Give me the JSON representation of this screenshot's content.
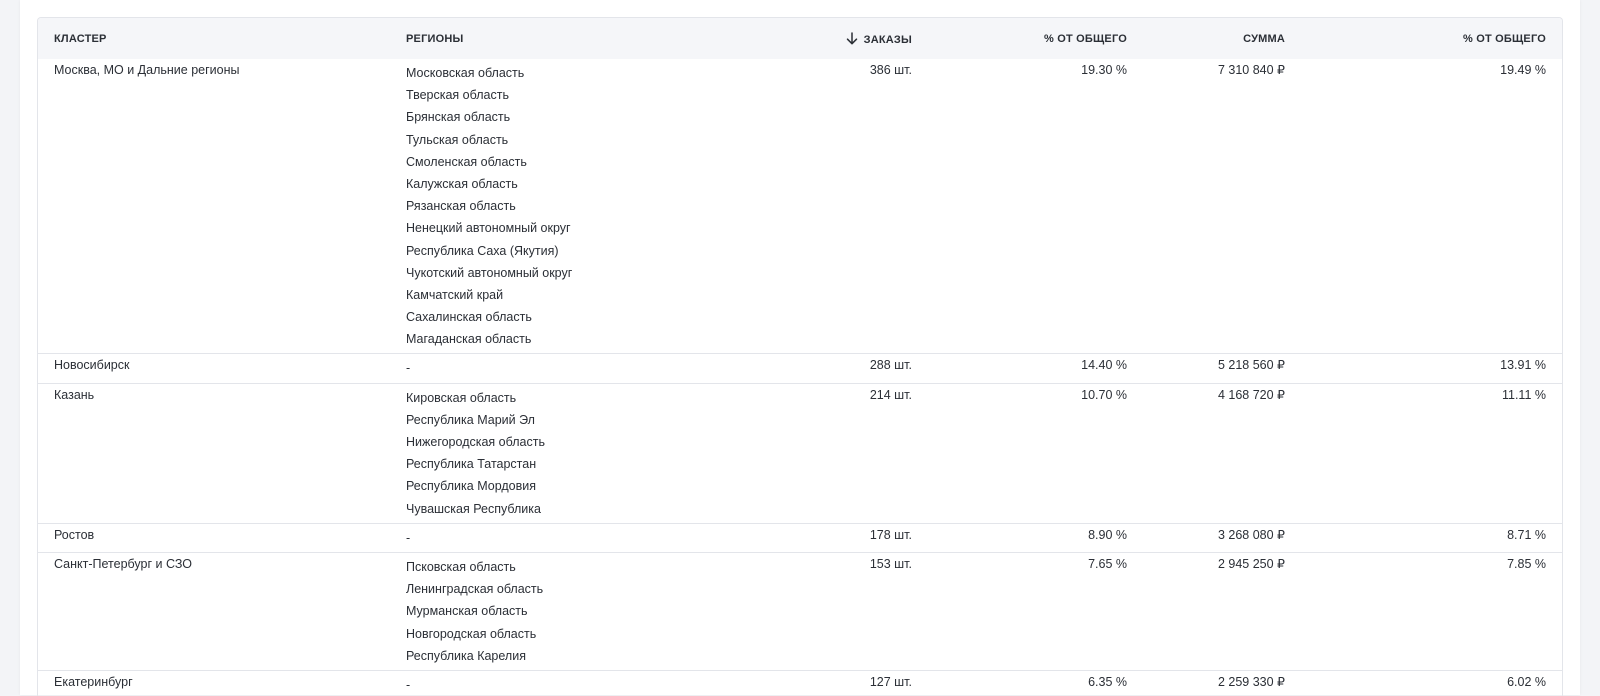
{
  "table": {
    "columns": {
      "cluster": "КЛАСТЕР",
      "regions": "РЕГИОНЫ",
      "orders": "ЗАКАЗЫ",
      "orders_pct": "% ОТ ОБЩЕГО",
      "sum": "СУММА",
      "sum_pct": "% ОТ ОБЩЕГО"
    },
    "sort": {
      "column": "orders",
      "direction": "desc",
      "icon": "arrow-down-icon"
    },
    "rows": [
      {
        "cluster": "Москва, МО и Дальние регионы",
        "regions": [
          "Московская область",
          "Тверская область",
          "Брянская область",
          "Тульская область",
          "Смоленская область",
          "Калужская область",
          "Рязанская область",
          "Ненецкий автономный округ",
          "Республика Саха (Якутия)",
          "Чукотский автономный округ",
          "Камчатский край",
          "Сахалинская область",
          "Магаданская область"
        ],
        "orders": "386 шт.",
        "orders_pct": "19.30 %",
        "sum": "7 310 840 ₽",
        "sum_pct": "19.49 %"
      },
      {
        "cluster": "Новосибирск",
        "regions": [
          "-"
        ],
        "orders": "288 шт.",
        "orders_pct": "14.40 %",
        "sum": "5 218 560 ₽",
        "sum_pct": "13.91 %"
      },
      {
        "cluster": "Казань",
        "regions": [
          "Кировская область",
          "Республика Марий Эл",
          "Нижегородская область",
          "Республика Татарстан",
          "Республика Мордовия",
          "Чувашская Республика"
        ],
        "orders": "214 шт.",
        "orders_pct": "10.70 %",
        "sum": "4 168 720 ₽",
        "sum_pct": "11.11 %"
      },
      {
        "cluster": "Ростов",
        "regions": [
          "-"
        ],
        "orders": "178 шт.",
        "orders_pct": "8.90 %",
        "sum": "3 268 080 ₽",
        "sum_pct": "8.71 %"
      },
      {
        "cluster": "Санкт-Петербург и СЗО",
        "regions": [
          "Псковская область",
          "Ленинградская область",
          "Мурманская область",
          "Новгородская область",
          "Республика Карелия"
        ],
        "orders": "153 шт.",
        "orders_pct": "7.65 %",
        "sum": "2 945 250 ₽",
        "sum_pct": "7.85 %"
      },
      {
        "cluster": "Екатеринбург",
        "regions": [
          "-"
        ],
        "orders": "127 шт.",
        "orders_pct": "6.35 %",
        "sum": "2 259 330 ₽",
        "sum_pct": "6.02 %"
      }
    ]
  }
}
